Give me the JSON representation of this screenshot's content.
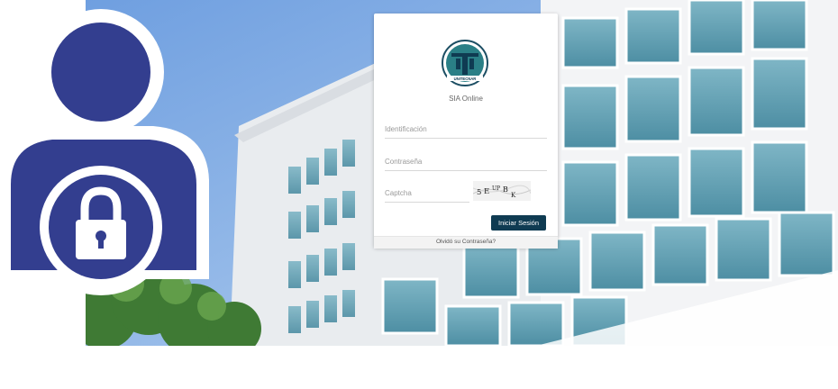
{
  "login": {
    "logo_text": "UNITECNAR",
    "app_name": "SIA Online",
    "id_placeholder": "Identificación",
    "password_placeholder": "Contraseña",
    "captcha_placeholder": "Captcha",
    "captcha_code": "5E UPB K",
    "login_button": "Iniciar Sesión",
    "forgot_password": "Olvidó su Contraseña?"
  },
  "colors": {
    "primary": "#0f3b52",
    "user_icon": "#333e8f",
    "logo_teal": "#2a7f86"
  },
  "icons": {
    "user": "user-icon",
    "lock": "lock-icon"
  }
}
